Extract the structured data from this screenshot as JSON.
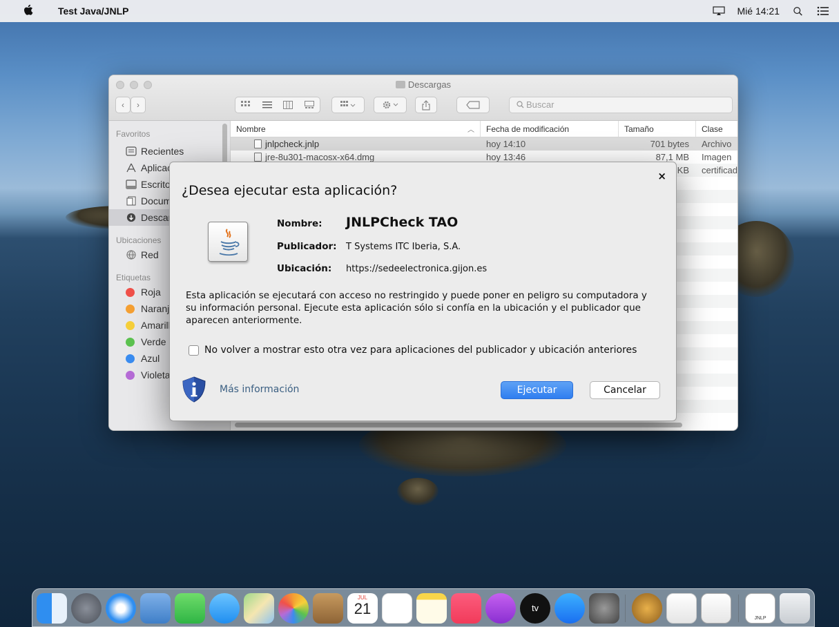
{
  "menubar": {
    "app_name": "Test Java/JNLP",
    "clock": "Mié 14:21"
  },
  "finder": {
    "title": "Descargas",
    "search_placeholder": "Buscar",
    "sidebar": {
      "favorites_header": "Favoritos",
      "favorites": [
        {
          "label": "Recientes",
          "icon": "recents-icon"
        },
        {
          "label": "Aplicaciones",
          "icon": "applications-icon"
        },
        {
          "label": "Escritorio",
          "icon": "desktop-icon"
        },
        {
          "label": "Documentos",
          "icon": "documents-icon"
        },
        {
          "label": "Descargas",
          "icon": "downloads-icon"
        }
      ],
      "locations_header": "Ubicaciones",
      "locations": [
        {
          "label": "Red",
          "icon": "network-icon"
        }
      ],
      "tags_header": "Etiquetas",
      "tags": [
        {
          "label": "Roja",
          "color": "#f0514a"
        },
        {
          "label": "Naranja",
          "color": "#f5a033"
        },
        {
          "label": "Amarillo",
          "color": "#f6cf3a"
        },
        {
          "label": "Verde",
          "color": "#5cc250"
        },
        {
          "label": "Azul",
          "color": "#3a8cf0"
        },
        {
          "label": "Violeta",
          "color": "#b56bd6"
        }
      ]
    },
    "columns": [
      "Nombre",
      "Fecha de modificación",
      "Tamaño",
      "Clase"
    ],
    "rows": [
      {
        "name": "jnlpcheck.jnlp",
        "date": "hoy 14:10",
        "size": "701 bytes",
        "kind": "Archivo"
      },
      {
        "name": "jre-8u301-macosx-x64.dmg",
        "date": "hoy 13:46",
        "size": "87,1 MB",
        "kind": "Imagen"
      },
      {
        "name": "",
        "date": "",
        "size": "KB",
        "kind": "certificado"
      }
    ]
  },
  "dialog": {
    "title": "¿Desea ejecutar esta aplicación?",
    "name_label": "Nombre:",
    "name_value": "JNLPCheck TAO",
    "publisher_label": "Publicador:",
    "publisher_value": "T Systems ITC Iberia, S.A.",
    "location_label": "Ubicación:",
    "location_value": "https://sedeelectronica.gijon.es",
    "warning": "Esta aplicación se ejecutará con acceso no restringido y puede poner en peligro su computadora y su información personal. Ejecute esta aplicación sólo si confía en la ubicación y el publicador que aparecen anteriormente.",
    "checkbox_label": "No volver a mostrar esto otra vez para aplicaciones del publicador y ubicación anteriores",
    "more_info": "Más información",
    "run_button": "Ejecutar",
    "cancel_button": "Cancelar",
    "close_glyph": "×"
  },
  "dock": {
    "items": [
      "finder-icon",
      "launchpad-icon",
      "safari-icon",
      "preview-icon",
      "facetime-icon",
      "messages-icon",
      "maps-icon",
      "photos-icon",
      "contacts-icon",
      "calendar-icon",
      "reminders-icon",
      "notes-icon",
      "music-icon",
      "podcasts-icon",
      "tv-icon",
      "app-store-icon",
      "system-preferences-icon",
      "keychain-icon",
      "textedit-icon",
      "java-icon",
      "jnlp-file-icon",
      "trash-icon"
    ],
    "calendar_month": "JUL",
    "calendar_day": "21",
    "tv_label": "tv",
    "jnlp_label": "JNLP"
  }
}
